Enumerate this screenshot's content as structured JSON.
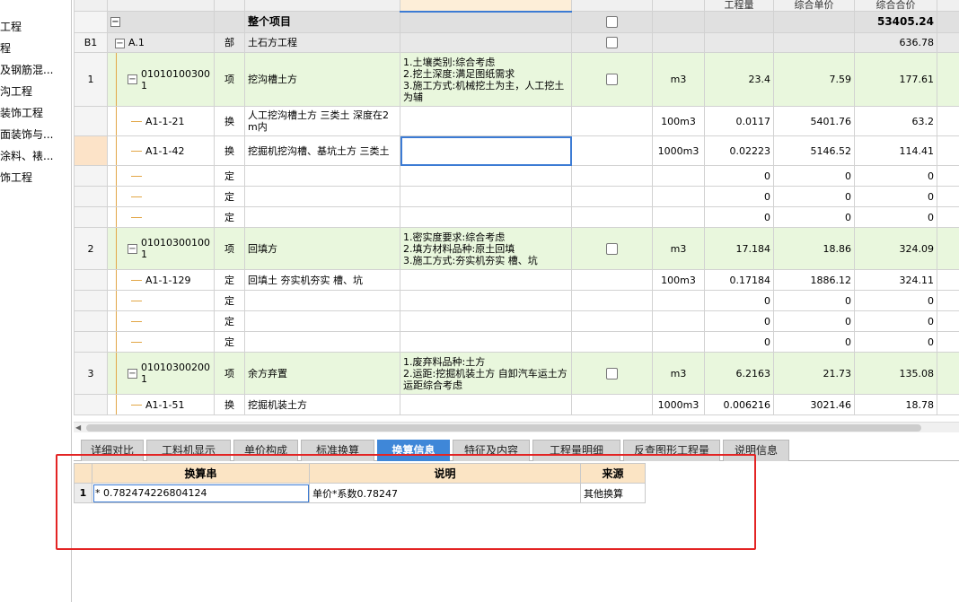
{
  "left_tree": {
    "items": [
      "工程",
      "程",
      "及钢筋混...",
      "沟工程",
      "装饰工程",
      "面装饰与...",
      "涂料、裱...",
      "饰工程"
    ]
  },
  "grid": {
    "header": [
      "",
      "",
      "",
      "",
      "",
      "",
      "",
      "工程量",
      "综合单价",
      "综合合价",
      ""
    ],
    "rows": [
      {
        "type": "project",
        "seq": "",
        "code": "",
        "kind": "",
        "name": "整个项目",
        "feature": "",
        "unit": "",
        "qty": "",
        "price": "",
        "total": "53405.24"
      },
      {
        "type": "part",
        "seq": "B1",
        "code": "A.1",
        "kind": "部",
        "name": "土石方工程",
        "feature": "",
        "unit": "",
        "qty": "",
        "price": "",
        "total": "636.78"
      },
      {
        "type": "item",
        "seq": "1",
        "code": "010101003001",
        "kind": "项",
        "name": "挖沟槽土方",
        "feature": "1.土壤类别:综合考虑\n2.挖土深度:满足图纸需求\n3.施工方式:机械挖土为主，人工挖土为辅",
        "unit": "m3",
        "qty": "23.4",
        "price": "7.59",
        "total": "177.61"
      },
      {
        "type": "norm",
        "seq": "",
        "code": "A1-1-21",
        "kind": "换",
        "name": "人工挖沟槽土方 三类土 深度在2m内",
        "feature": "",
        "unit": "100m3",
        "qty": "0.0117",
        "price": "5401.76",
        "total": "63.2"
      },
      {
        "type": "norm",
        "seq": "",
        "code": "A1-1-42",
        "kind": "换",
        "name": "挖掘机挖沟槽、基坑土方 三类土",
        "feature": "",
        "unit": "1000m3",
        "qty": "0.02223",
        "price": "5146.52",
        "total": "114.41"
      },
      {
        "type": "norm",
        "seq": "",
        "code": "",
        "kind": "定",
        "name": "",
        "feature": "",
        "unit": "",
        "qty": "0",
        "price": "0",
        "total": "0"
      },
      {
        "type": "norm",
        "seq": "",
        "code": "",
        "kind": "定",
        "name": "",
        "feature": "",
        "unit": "",
        "qty": "0",
        "price": "0",
        "total": "0"
      },
      {
        "type": "norm",
        "seq": "",
        "code": "",
        "kind": "定",
        "name": "",
        "feature": "",
        "unit": "",
        "qty": "0",
        "price": "0",
        "total": "0"
      },
      {
        "type": "item",
        "seq": "2",
        "code": "010103001001",
        "kind": "项",
        "name": "回填方",
        "feature": "1.密实度要求:综合考虑\n2.填方材料品种:原土回填\n3.施工方式:夯实机夯实 槽、坑",
        "unit": "m3",
        "qty": "17.184",
        "price": "18.86",
        "total": "324.09"
      },
      {
        "type": "norm",
        "seq": "",
        "code": "A1-1-129",
        "kind": "定",
        "name": "回填土 夯实机夯实 槽、坑",
        "feature": "",
        "unit": "100m3",
        "qty": "0.17184",
        "price": "1886.12",
        "total": "324.11"
      },
      {
        "type": "norm",
        "seq": "",
        "code": "",
        "kind": "定",
        "name": "",
        "feature": "",
        "unit": "",
        "qty": "0",
        "price": "0",
        "total": "0"
      },
      {
        "type": "norm",
        "seq": "",
        "code": "",
        "kind": "定",
        "name": "",
        "feature": "",
        "unit": "",
        "qty": "0",
        "price": "0",
        "total": "0"
      },
      {
        "type": "norm",
        "seq": "",
        "code": "",
        "kind": "定",
        "name": "",
        "feature": "",
        "unit": "",
        "qty": "0",
        "price": "0",
        "total": "0"
      },
      {
        "type": "item",
        "seq": "3",
        "code": "010103002001",
        "kind": "项",
        "name": "余方弃置",
        "feature": "1.废弃料品种:土方\n2.运距:挖掘机装土方 自卸汽车运土方 运距综合考虑",
        "unit": "m3",
        "qty": "6.2163",
        "price": "21.73",
        "total": "135.08"
      },
      {
        "type": "norm",
        "seq": "",
        "code": "A1-1-51",
        "kind": "换",
        "name": "挖掘机装土方",
        "feature": "",
        "unit": "1000m3",
        "qty": "0.006216",
        "price": "3021.46",
        "total": "18.78"
      }
    ]
  },
  "tabs": [
    "详细对比",
    "工料机显示",
    "单价构成",
    "标准换算",
    "换算信息",
    "特征及内容",
    "工程量明细",
    "反查图形工程量",
    "说明信息"
  ],
  "active_tab": "换算信息",
  "conversion_table": {
    "headers": [
      "换算串",
      "说明",
      "来源"
    ],
    "rows": [
      {
        "seq": "1",
        "expr": "* 0.782474226804124",
        "desc": "单价*系数0.78247",
        "source": "其他换算"
      }
    ]
  },
  "colors": {
    "item_row": "#e9f7dd",
    "project_row": "#e0e0e0",
    "active_tab": "#3f87d8",
    "highlight_box": "#e32424",
    "sub_header": "#fbe4c4"
  }
}
